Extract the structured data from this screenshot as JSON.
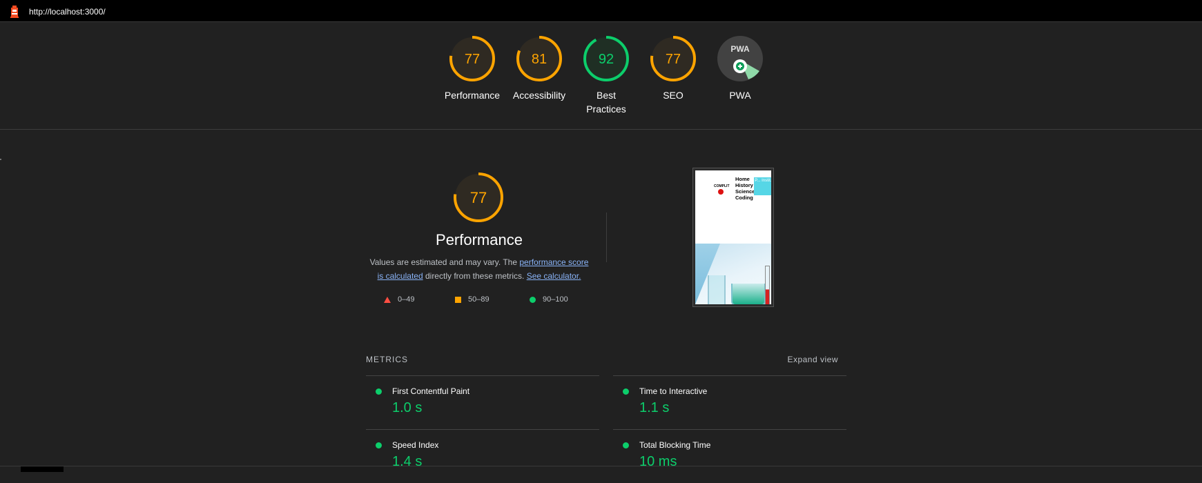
{
  "topbar": {
    "url": "http://localhost:3000/",
    "logo_icon": "lighthouse-icon"
  },
  "colors": {
    "pass": "#0cce6b",
    "average": "#ffa400",
    "fail": "#ff4e42",
    "link": "#8ab4f8"
  },
  "gauges": [
    {
      "score": "77",
      "label": "Performance",
      "status": "average",
      "fraction": 0.77
    },
    {
      "score": "81",
      "label": "Accessibility",
      "status": "average",
      "fraction": 0.81
    },
    {
      "score": "92",
      "label": "Best Practices",
      "status": "pass",
      "fraction": 0.92
    },
    {
      "score": "77",
      "label": "SEO",
      "status": "average",
      "fraction": 0.77
    },
    {
      "score": "PWA",
      "label": "PWA",
      "status": "pwa",
      "icon": "pwa-badge-icon"
    }
  ],
  "performance": {
    "score": "77",
    "fraction": 0.77,
    "title": "Performance",
    "desc_prefix": "Values are estimated and may vary. The ",
    "desc_link1": "performance score is calculated",
    "desc_middle": " directly from these metrics. ",
    "desc_link2": "See calculator."
  },
  "legend": [
    {
      "shape": "triangle",
      "range": "0–49"
    },
    {
      "shape": "square",
      "range": "50–89"
    },
    {
      "shape": "circle",
      "range": "90–100"
    }
  ],
  "screenshot": {
    "logo_text": "COMPLIT",
    "nav": [
      "Home",
      "History",
      "Science",
      "Coding"
    ],
    "button_text": "P... Instit..."
  },
  "metrics": {
    "header": "METRICS",
    "expand_label": "Expand view",
    "left": [
      {
        "title": "First Contentful Paint",
        "value": "1.0 s"
      },
      {
        "title": "Speed Index",
        "value": "1.4 s"
      }
    ],
    "right": [
      {
        "title": "Time to Interactive",
        "value": "1.1 s"
      },
      {
        "title": "Total Blocking Time",
        "value": "10 ms"
      }
    ]
  }
}
